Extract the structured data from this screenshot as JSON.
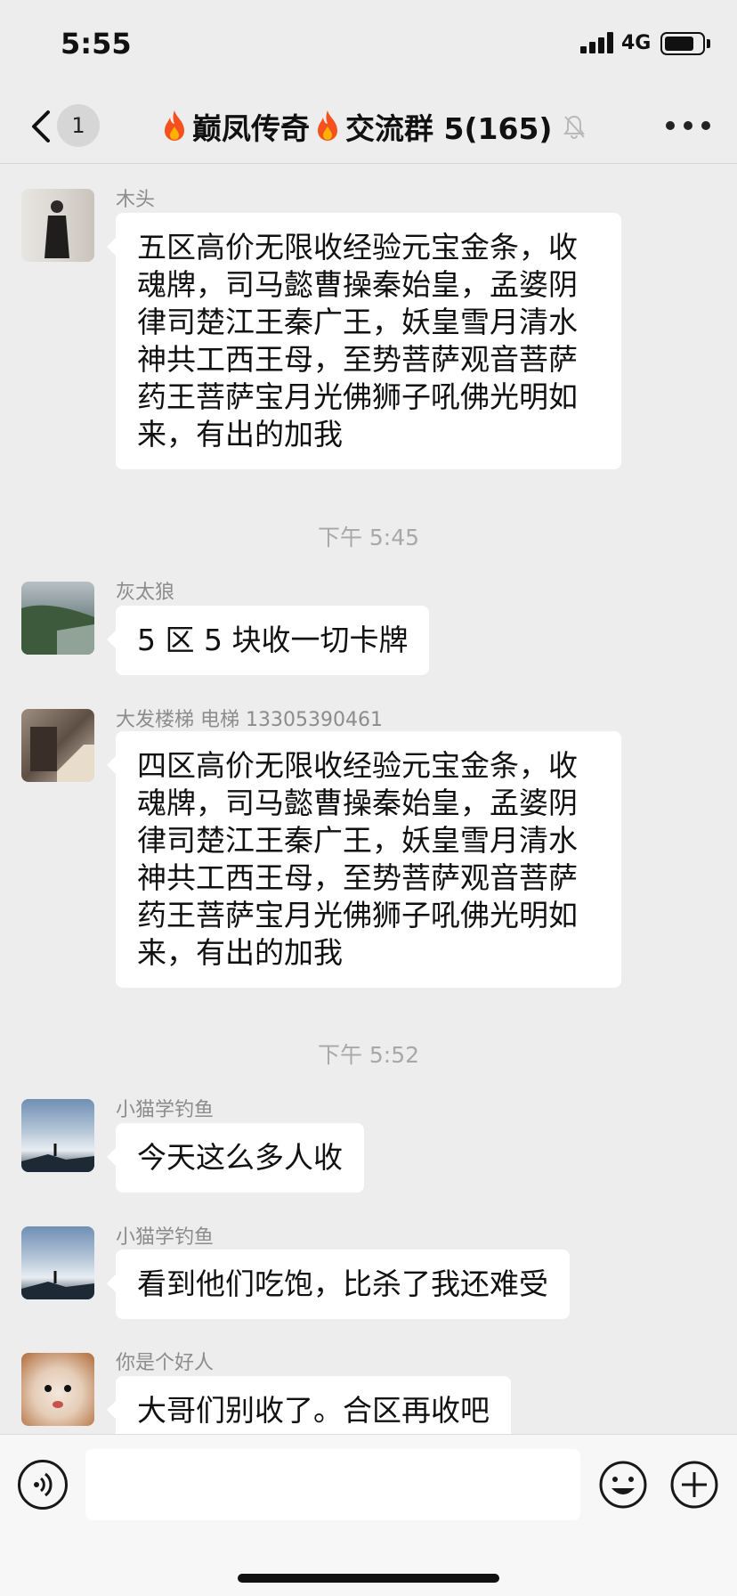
{
  "status_bar": {
    "time": "5:55",
    "network": "4G",
    "battery_level": 0.8
  },
  "header": {
    "back_badge": "1",
    "title_part1": "巅凤传奇",
    "title_part2": "交流群 5(165)",
    "icons": [
      "back-chevron-icon",
      "fire-icon",
      "fire-icon",
      "mute-bell-icon",
      "more-dots-icon"
    ]
  },
  "messages": [
    {
      "sender": "木头",
      "text": "五区高价无限收经验元宝金条，收魂牌，司马懿曹操秦始皇，孟婆阴律司楚江王秦广王，妖皇雪月清水神共工西王母，至势菩萨观音菩萨药王菩萨宝月光佛狮子吼佛光明如来，有出的加我"
    },
    {
      "timestamp": "下午 5:45"
    },
    {
      "sender": "灰太狼",
      "text": "5 区 5 块收一切卡牌"
    },
    {
      "sender": "大发楼梯  电梯  13305390461",
      "text": "四区高价无限收经验元宝金条，收魂牌，司马懿曹操秦始皇，孟婆阴律司楚江王秦广王，妖皇雪月清水神共工西王母，至势菩萨观音菩萨药王菩萨宝月光佛狮子吼佛光明如来，有出的加我"
    },
    {
      "timestamp": "下午 5:52"
    },
    {
      "sender": "小猫学钓鱼",
      "text": "今天这么多人收"
    },
    {
      "sender": "小猫学钓鱼",
      "text": "看到他们吃饱，比杀了我还难受"
    },
    {
      "sender": "你是个好人",
      "text": "大哥们别收了。合区再收吧"
    }
  ],
  "input_bar": {
    "value": "",
    "icons": [
      "voice-icon",
      "emoji-icon",
      "plus-icon"
    ]
  },
  "colors": {
    "background": "#ededed",
    "bubble": "#ffffff",
    "sender": "#8c8c8c",
    "timestamp": "#a8a8a8",
    "flame": "#f4511e"
  }
}
